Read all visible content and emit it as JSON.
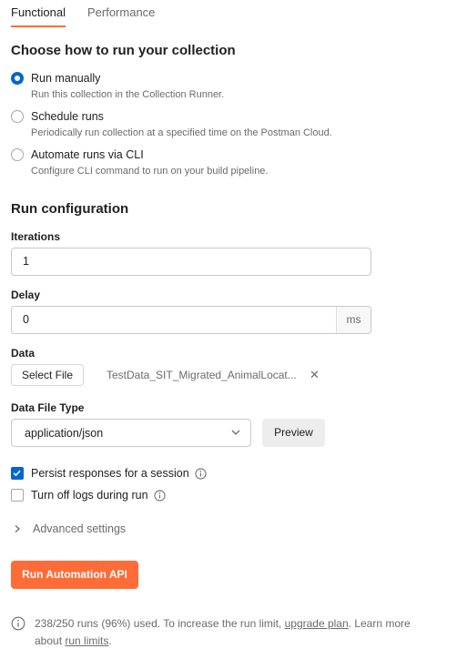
{
  "tabs": [
    {
      "label": "Functional",
      "active": true
    },
    {
      "label": "Performance",
      "active": false
    }
  ],
  "run_section": {
    "title": "Choose how to run your collection",
    "options": [
      {
        "label": "Run manually",
        "desc": "Run this collection in the Collection Runner.",
        "selected": true
      },
      {
        "label": "Schedule runs",
        "desc": "Periodically run collection at a specified time on the Postman Cloud.",
        "selected": false
      },
      {
        "label": "Automate runs via CLI",
        "desc": "Configure CLI command to run on your build pipeline.",
        "selected": false
      }
    ]
  },
  "config": {
    "title": "Run configuration",
    "iterations_label": "Iterations",
    "iterations_value": "1",
    "delay_label": "Delay",
    "delay_value": "0",
    "delay_unit": "ms",
    "data_label": "Data",
    "select_file_label": "Select File",
    "file_name": "TestData_SIT_Migrated_AnimalLocat...",
    "file_remove_glyph": "✕",
    "data_type_label": "Data File Type",
    "data_type_value": "application/json",
    "preview_label": "Preview",
    "persist_label": "Persist responses for a session",
    "persist_checked": true,
    "logs_label": "Turn off logs during run",
    "logs_checked": false,
    "advanced_label": "Advanced settings"
  },
  "primary_button": "Run Automation API",
  "footer": {
    "text_before": "238/250 runs (96%) used. To increase the run limit, ",
    "upgrade_link": "upgrade plan",
    "text_middle": ". Learn more about ",
    "limits_link": "run limits",
    "text_after": "."
  },
  "colors": {
    "accent": "#ff6c37",
    "selected_blue": "#0265d2"
  }
}
